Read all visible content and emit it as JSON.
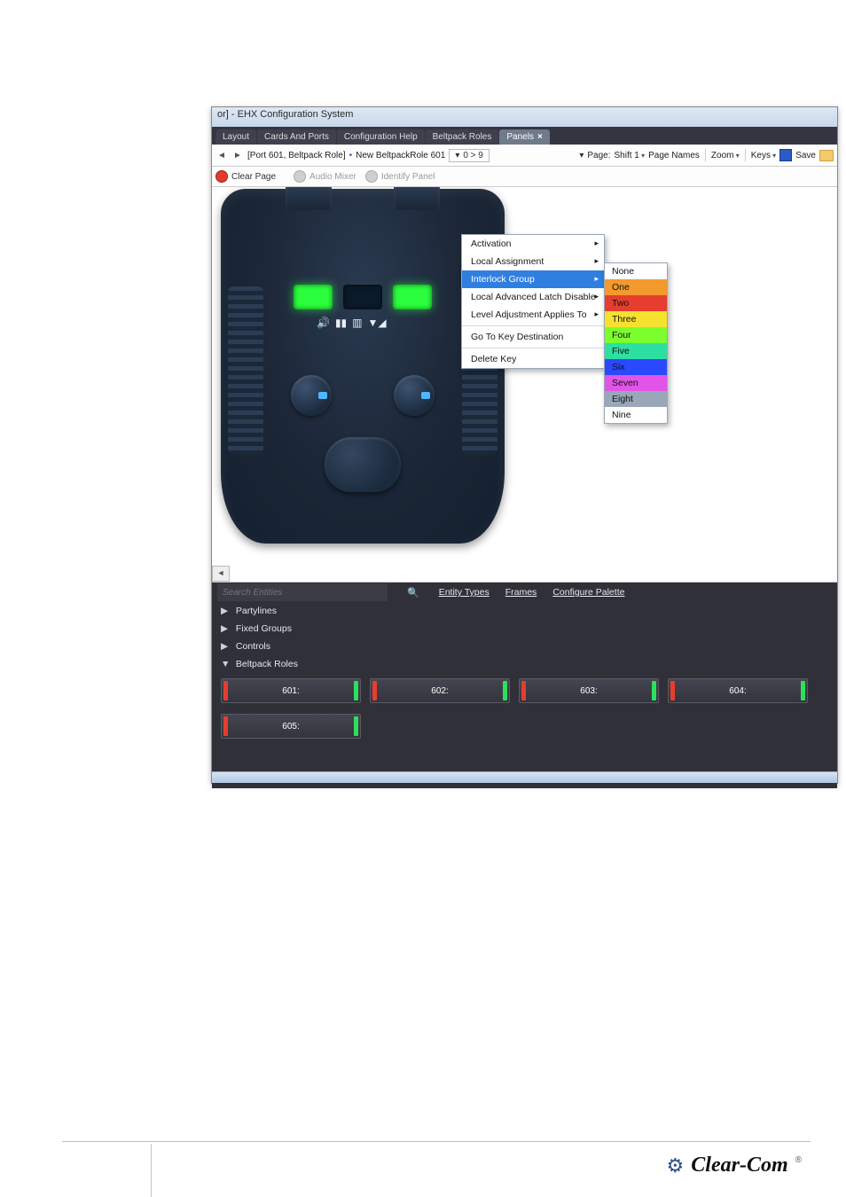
{
  "window": {
    "title_fragment": "or] - EHX Configuration System"
  },
  "tabs": [
    {
      "label": "Layout",
      "active": false
    },
    {
      "label": "Cards And Ports",
      "active": false
    },
    {
      "label": "Configuration Help",
      "active": false
    },
    {
      "label": "Beltpack Roles",
      "active": false
    },
    {
      "label": "Panels",
      "active": true
    }
  ],
  "breadcrumb": {
    "port": "[Port 601, Beltpack Role]",
    "role_name": "New BeltpackRole 601",
    "pager": "0 > 9"
  },
  "right_toolbar": {
    "page_label": "Page:",
    "page_value": "Shift 1",
    "page_names": "Page Names",
    "zoom": "Zoom",
    "keys": "Keys",
    "save": "Save"
  },
  "action_bar": {
    "clear_page": "Clear Page",
    "audio_mixer": "Audio Mixer",
    "identify_panel": "Identify Panel"
  },
  "context_menu": {
    "items": [
      {
        "label": "Activation",
        "has_sub": true
      },
      {
        "label": "Local Assignment",
        "has_sub": true
      },
      {
        "label": "Interlock Group",
        "has_sub": true,
        "highlight": true
      },
      {
        "label": "Local Advanced Latch Disable",
        "has_sub": true
      },
      {
        "label": "Level Adjustment Applies To",
        "has_sub": true
      },
      {
        "label": "Go To Key Destination",
        "has_sub": false
      },
      {
        "label": "Delete Key",
        "has_sub": false
      }
    ]
  },
  "interlock_submenu": [
    {
      "label": "None",
      "class": "none"
    },
    {
      "label": "One",
      "class": "c-one"
    },
    {
      "label": "Two",
      "class": "c-two"
    },
    {
      "label": "Three",
      "class": "c-three"
    },
    {
      "label": "Four",
      "class": "c-four"
    },
    {
      "label": "Five",
      "class": "c-five"
    },
    {
      "label": "Six",
      "class": "c-six"
    },
    {
      "label": "Seven",
      "class": "c-seven"
    },
    {
      "label": "Eight",
      "class": "c-eight"
    },
    {
      "label": "Nine",
      "class": "c-nine"
    }
  ],
  "palette": {
    "search_placeholder": "Search Entities",
    "links": {
      "entity_types": "Entity Types",
      "frames": "Frames",
      "configure": "Configure Palette"
    },
    "categories": [
      {
        "label": "Partylines",
        "expanded": false
      },
      {
        "label": "Fixed Groups",
        "expanded": false
      },
      {
        "label": "Controls",
        "expanded": false
      },
      {
        "label": "Beltpack Roles",
        "expanded": true
      }
    ],
    "roles": [
      {
        "label": "601:"
      },
      {
        "label": "602:"
      },
      {
        "label": "603:"
      },
      {
        "label": "604:"
      },
      {
        "label": "605:"
      }
    ]
  },
  "footer": {
    "brand": "Clear-Com"
  }
}
